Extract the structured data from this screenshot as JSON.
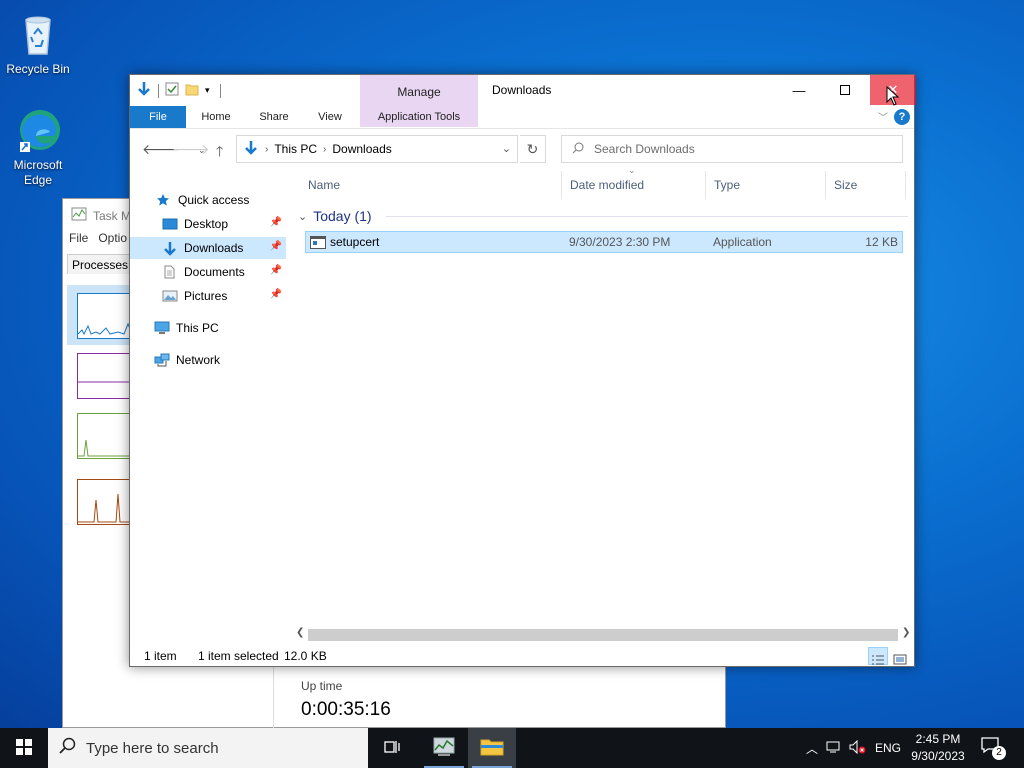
{
  "desktop": {
    "icons": [
      {
        "label": "Recycle Bin",
        "icon": "recycle-bin-icon"
      },
      {
        "label": "Microsoft Edge",
        "icon": "edge-icon"
      }
    ]
  },
  "task_manager": {
    "title": "Task M",
    "menu": [
      "File",
      "Optio"
    ],
    "tab": "Processes",
    "uptime_label": "Up time",
    "uptime_value": "0:00:35:16"
  },
  "explorer": {
    "window_title": "Downloads",
    "context_tab": "Manage",
    "ribbon_tabs": [
      "File",
      "Home",
      "Share",
      "View",
      "Application Tools"
    ],
    "address": {
      "segments": [
        "This PC",
        "Downloads"
      ]
    },
    "search_placeholder": "Search Downloads",
    "nav_pane": {
      "quick_access": "Quick access",
      "items": [
        {
          "label": "Desktop",
          "pinned": true
        },
        {
          "label": "Downloads",
          "pinned": true,
          "selected": true
        },
        {
          "label": "Documents",
          "pinned": true
        },
        {
          "label": "Pictures",
          "pinned": true
        }
      ],
      "this_pc": "This PC",
      "network": "Network"
    },
    "columns": [
      "Name",
      "Date modified",
      "Type",
      "Size"
    ],
    "group": "Today (1)",
    "files": [
      {
        "name": "setupcert",
        "date": "9/30/2023 2:30 PM",
        "type": "Application",
        "size": "12 KB",
        "selected": true
      }
    ],
    "status": {
      "count": "1 item",
      "selection": "1 item selected",
      "size": "12.0 KB"
    }
  },
  "taskbar": {
    "search_placeholder": "Type here to search",
    "language": "ENG",
    "time": "2:45 PM",
    "date": "9/30/2023",
    "notifications": "2"
  },
  "colors": {
    "accent": "#1979ca",
    "selection": "#cce8ff",
    "context": "#e9d6f2",
    "close": "#e81123"
  }
}
